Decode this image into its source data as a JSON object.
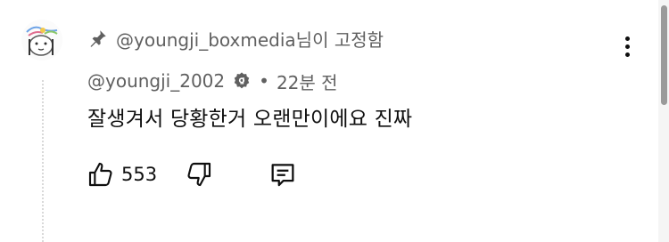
{
  "pinned": {
    "text": "@youngji_boxmedia님이 고정함",
    "icon": "pin-icon"
  },
  "comment": {
    "author": "@youngji_2002",
    "verified_icon": "verified-icon",
    "separator": "•",
    "timestamp": "22분 전",
    "text": "잘생겨서 당황한거 오랜만이에요 진짜",
    "likes": "553"
  },
  "colors": {
    "secondary_text": "#606060",
    "primary_text": "#0f0f0f"
  }
}
